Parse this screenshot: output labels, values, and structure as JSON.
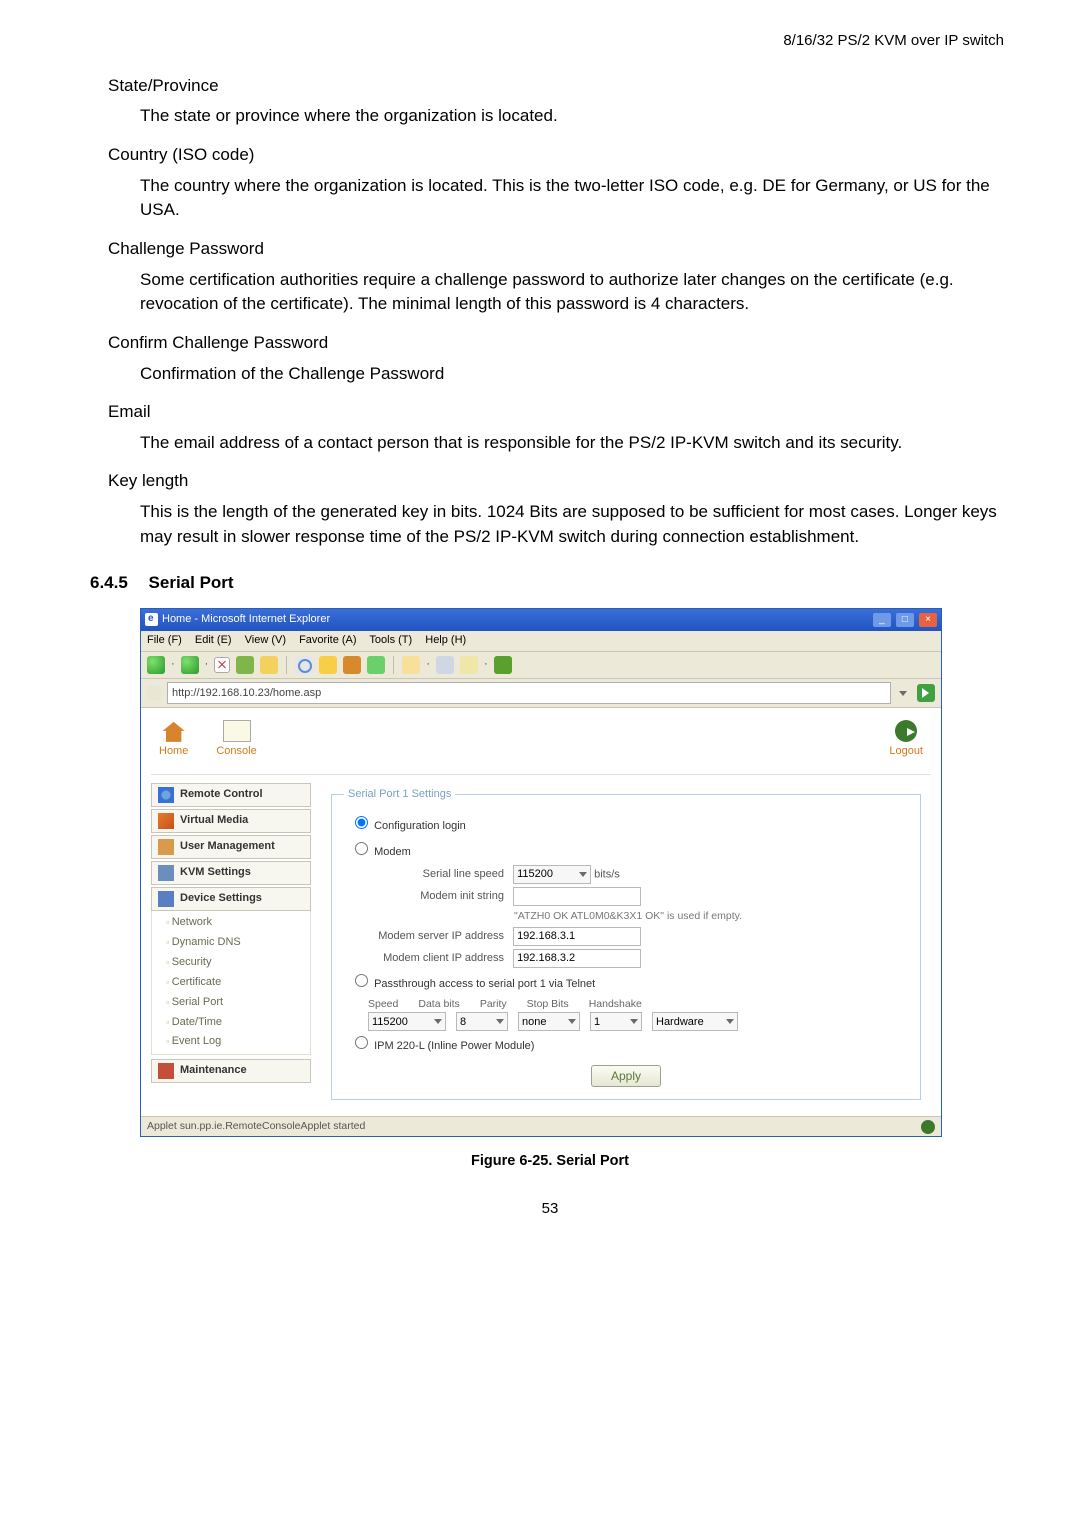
{
  "header_right": "8/16/32 PS/2 KVM over IP switch",
  "terms": {
    "state": {
      "label": "State/Province",
      "desc": "The state or province where the organization is located."
    },
    "country": {
      "label": "Country (ISO code)",
      "desc": "The country where the organization is located. This is the two-letter ISO code, e.g. DE for Germany, or US for the USA."
    },
    "challenge": {
      "label": "Challenge Password",
      "desc": "Some certification authorities require a challenge password to authorize later changes on the certificate (e.g. revocation of the certificate). The minimal length of this password is 4 characters."
    },
    "confirm": {
      "label": "Confirm Challenge Password",
      "desc": "Confirmation of the Challenge Password"
    },
    "email": {
      "label": "Email",
      "desc": "The email address of a contact person that is responsible for the PS/2 IP-KVM switch and its security."
    },
    "keylen": {
      "label": "Key length",
      "desc": "This is the length of the generated key in bits. 1024 Bits are supposed to be sufficient for most cases. Longer keys may result in slower response time of the PS/2 IP-KVM switch during connection establishment."
    }
  },
  "section": {
    "number": "6.4.5",
    "title": "Serial Port"
  },
  "ie": {
    "title": "Home - Microsoft Internet Explorer",
    "menu": {
      "file": "File (F)",
      "edit": "Edit (E)",
      "view": "View (V)",
      "favorite": "Favorite (A)",
      "tools": "Tools (T)",
      "help": "Help (H)"
    },
    "address": "http://192.168.10.23/home.asp",
    "status": "Applet sun.pp.ie.RemoteConsoleApplet started"
  },
  "topnav": {
    "home": "Home",
    "console": "Console",
    "logout": "Logout"
  },
  "sidebar": {
    "remote": "Remote Control",
    "virtual": "Virtual Media",
    "usermgmt": "User Management",
    "kvm": "KVM Settings",
    "device": "Device Settings",
    "sub": {
      "network": "Network",
      "ddns": "Dynamic DNS",
      "security": "Security",
      "cert": "Certificate",
      "serial": "Serial Port",
      "datetime": "Date/Time",
      "eventlog": "Event Log"
    },
    "maint": "Maintenance"
  },
  "serial": {
    "legend": "Serial Port 1 Settings",
    "opt_config": "Configuration login",
    "opt_modem": "Modem",
    "line_speed_label": "Serial line speed",
    "line_speed_value": "115200",
    "line_speed_unit": "bits/s",
    "init_label": "Modem init string",
    "init_value": "",
    "init_hint": "\"ATZH0 OK ATL0M0&K3X1 OK\" is used if empty.",
    "server_ip_label": "Modem server IP address",
    "server_ip_value": "192.168.3.1",
    "client_ip_label": "Modem client IP address",
    "client_ip_value": "192.168.3.2",
    "opt_passthru": "Passthrough access to serial port 1 via Telnet",
    "passthru_headers": {
      "speed": "Speed",
      "databits": "Data bits",
      "parity": "Parity",
      "stopbits": "Stop Bits",
      "handshake": "Handshake"
    },
    "passthru_values": {
      "speed": "115200",
      "databits": "8",
      "parity": "none",
      "stopbits": "1",
      "handshake": "Hardware"
    },
    "opt_ipm": "IPM 220-L (Inline Power Module)",
    "apply": "Apply"
  },
  "figure_caption": "Figure 6-25. Serial Port",
  "page_number": "53"
}
